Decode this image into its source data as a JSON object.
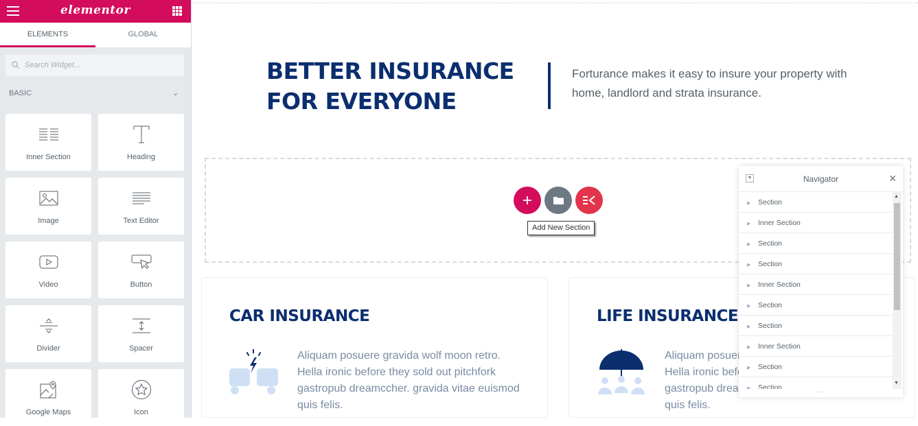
{
  "app": {
    "logo": "elementor"
  },
  "tabs": [
    {
      "label": "ELEMENTS"
    },
    {
      "label": "GLOBAL"
    }
  ],
  "search": {
    "placeholder": "Search Widget..."
  },
  "category": {
    "label": "BASIC"
  },
  "widgets": [
    {
      "label": "Inner Section",
      "icon": "inner-section-icon"
    },
    {
      "label": "Heading",
      "icon": "heading-icon"
    },
    {
      "label": "Image",
      "icon": "image-icon"
    },
    {
      "label": "Text Editor",
      "icon": "text-editor-icon"
    },
    {
      "label": "Video",
      "icon": "video-icon"
    },
    {
      "label": "Button",
      "icon": "button-icon"
    },
    {
      "label": "Divider",
      "icon": "divider-icon"
    },
    {
      "label": "Spacer",
      "icon": "spacer-icon"
    },
    {
      "label": "Google Maps",
      "icon": "google-maps-icon"
    },
    {
      "label": "Icon",
      "icon": "star-icon"
    }
  ],
  "hero": {
    "heading_line1": "BETTER INSURANCE",
    "heading_line2": "FOR EVERYONE",
    "tagline": "Forturance makes it easy to insure your property with home, landlord and strata insurance."
  },
  "add_section": {
    "tooltip": "Add New Section"
  },
  "cards": [
    {
      "title": "CAR INSURANCE",
      "body": "Aliquam posuere gravida wolf moon retro. Hella ironic before they sold out pitchfork gastropub dreamccher. gravida vitae euismod quis felis.",
      "icon": "car-crash-icon"
    },
    {
      "title": "LIFE INSURANCE",
      "body": "Aliquam posuere gravida wolf moon retro. Hella ironic before they sold out pitchfork gastropub dreamccher. gravida vitae euismod quis felis.",
      "icon": "umbrella-family-icon"
    }
  ],
  "navigator": {
    "title": "Navigator",
    "items": [
      "Section",
      "Inner Section",
      "Section",
      "Section",
      "Inner Section",
      "Section",
      "Section",
      "Inner Section",
      "Section",
      "Section"
    ]
  },
  "colors": {
    "brand": "#d30c5c",
    "navy": "#0b2e6f",
    "template_gray": "#6d7882",
    "kit_red": "#e2344b"
  }
}
